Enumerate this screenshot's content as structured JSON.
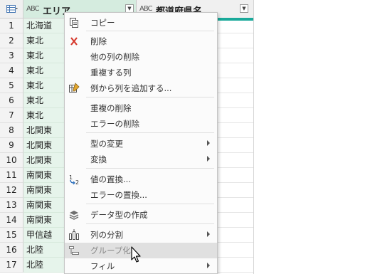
{
  "grid": {
    "columns": [
      {
        "type_icon": "ABC",
        "title": "エリア"
      },
      {
        "type_icon": "ABC",
        "title": "都道府県名"
      }
    ],
    "row_numbers": [
      "1",
      "2",
      "3",
      "4",
      "5",
      "6",
      "7",
      "8",
      "9",
      "10",
      "11",
      "12",
      "13",
      "14",
      "15",
      "16",
      "17"
    ],
    "area_values": [
      "北海道",
      "東北",
      "東北",
      "東北",
      "東北",
      "東北",
      "東北",
      "北関東",
      "北関東",
      "北関東",
      "南関東",
      "南関東",
      "南関東",
      "南関東",
      "甲信越",
      "北陸",
      "北陸"
    ]
  },
  "context_menu": {
    "items": [
      {
        "label": "コピー",
        "icon": "copy-icon"
      },
      {
        "label": "削除",
        "icon": "delete-icon"
      },
      {
        "label": "他の列の削除",
        "icon": ""
      },
      {
        "label": "重複する列",
        "icon": ""
      },
      {
        "label": "例から列を追加する...",
        "icon": "add-column-from-examples-icon"
      },
      {
        "label": "重複の削除",
        "icon": ""
      },
      {
        "label": "エラーの削除",
        "icon": ""
      },
      {
        "label": "型の変更",
        "icon": "",
        "submenu": true
      },
      {
        "label": "変換",
        "icon": "",
        "submenu": true
      },
      {
        "label": "値の置換...",
        "icon": "replace-values-icon"
      },
      {
        "label": "エラーの置換...",
        "icon": ""
      },
      {
        "label": "データ型の作成",
        "icon": "create-data-type-icon"
      },
      {
        "label": "列の分割",
        "icon": "split-column-icon",
        "submenu": true
      },
      {
        "label": "グループ化...",
        "icon": "group-by-icon",
        "highlighted": true
      },
      {
        "label": "フィル",
        "icon": "",
        "submenu": true
      }
    ]
  },
  "colors": {
    "area_column_header": "#d5ecdf",
    "area_column_cells": "#e6f4eb",
    "teal_accent": "#1aa99a",
    "menu_highlight": "#e0e0e0"
  }
}
